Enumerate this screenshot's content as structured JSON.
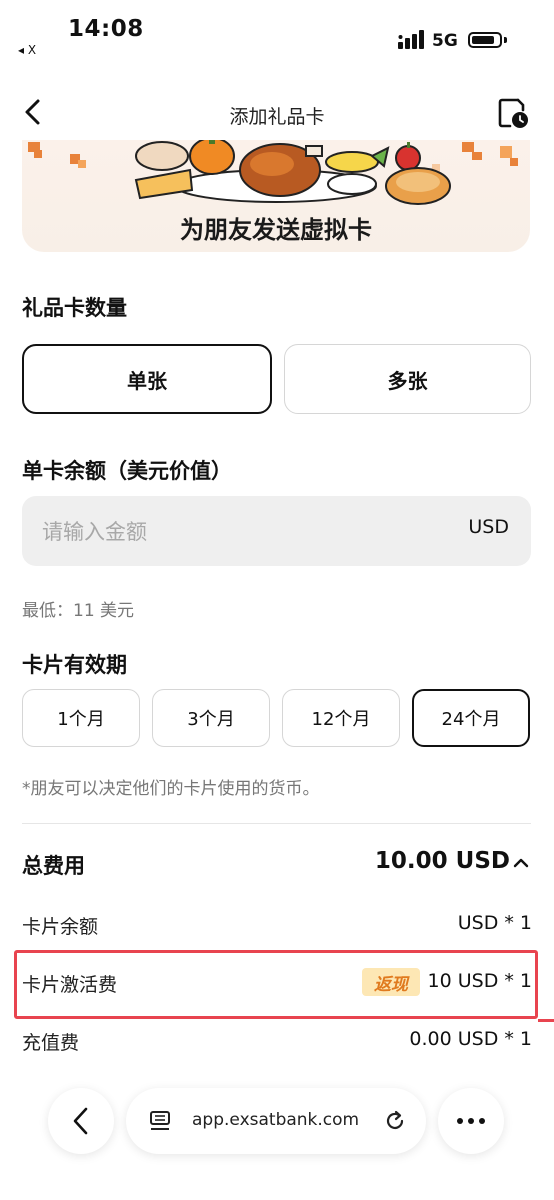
{
  "status_bar": {
    "time": "14:08",
    "back_app": "◂ X",
    "network": "5G"
  },
  "nav": {
    "title": "添加礼品卡"
  },
  "banner": {
    "title": "为朋友发送虚拟卡"
  },
  "quantity": {
    "title": "礼品卡数量",
    "single": "单张",
    "multiple": "多张",
    "selected": "单张"
  },
  "amount": {
    "title": "单卡余额（美元价值）",
    "placeholder": "请输入金额",
    "unit": "USD",
    "minimum": "最低：11 美元"
  },
  "validity": {
    "title": "卡片有效期",
    "options": [
      "1个月",
      "3个月",
      "12个月",
      "24个月"
    ],
    "selected": "24个月",
    "note": "*朋友可以决定他们的卡片使用的货币。"
  },
  "fees": {
    "total_label": "总费用",
    "total_value": "10.00 USD",
    "rows": [
      {
        "label": "卡片余额",
        "value": "USD * 1"
      },
      {
        "label": "卡片激活费",
        "badge": "返现",
        "value": "10 USD * 1"
      },
      {
        "label": "充值费",
        "value": "0.00 USD * 1"
      }
    ]
  },
  "browser": {
    "url": "app.exsatbank.com"
  },
  "colors": {
    "highlight_red": "#e8444f",
    "cashback_bg": "#fde7b4",
    "cashback_text": "#e07a1e"
  }
}
